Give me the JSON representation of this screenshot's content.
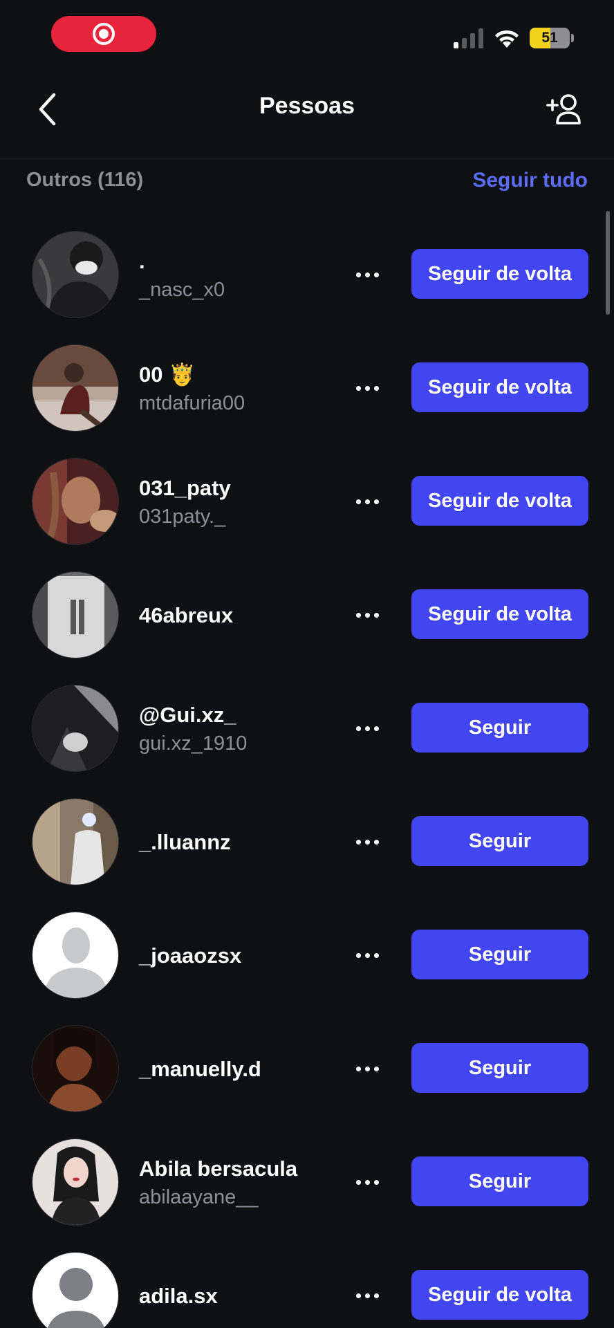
{
  "status_bar": {
    "battery_level": "51",
    "battery_fraction": 0.51,
    "record_icon": "record-icon",
    "signal_icon": "cellular-signal-icon",
    "wifi_icon": "wifi-icon"
  },
  "header": {
    "title": "Pessoas",
    "back_icon": "chevron-left-icon",
    "add_icon": "add-person-icon"
  },
  "section": {
    "title": "Outros (116)",
    "follow_all_label": "Seguir tudo"
  },
  "colors": {
    "background": "#0f1013",
    "accent": "#4246f0",
    "link": "#5b6cf5",
    "secondary_text": "#8d9099"
  },
  "people": [
    {
      "display_name": ".",
      "username": "_nasc_x0",
      "button_label": "Seguir de volta",
      "avatar": "photo"
    },
    {
      "display_name": "00 🤴",
      "username": "mtdafuria00",
      "button_label": "Seguir de volta",
      "avatar": "photo"
    },
    {
      "display_name": "031_paty",
      "username": "031paty._",
      "button_label": "Seguir de volta",
      "avatar": "photo"
    },
    {
      "display_name": "46abreux",
      "username": "",
      "button_label": "Seguir de volta",
      "avatar": "photo"
    },
    {
      "display_name": "@Gui.xz_",
      "username": "gui.xz_1910",
      "button_label": "Seguir",
      "avatar": "photo"
    },
    {
      "display_name": "_.lluannz",
      "username": "",
      "button_label": "Seguir",
      "avatar": "photo"
    },
    {
      "display_name": "_joaaozsx",
      "username": "",
      "button_label": "Seguir",
      "avatar": "default-silhouette"
    },
    {
      "display_name": "_manuelly.d",
      "username": "",
      "button_label": "Seguir",
      "avatar": "photo"
    },
    {
      "display_name": "Abila bersacula",
      "username": "abilaayane__",
      "button_label": "Seguir",
      "avatar": "photo"
    },
    {
      "display_name": "adila.sx",
      "username": "",
      "button_label": "Seguir de volta",
      "avatar": "default-avatar"
    }
  ]
}
